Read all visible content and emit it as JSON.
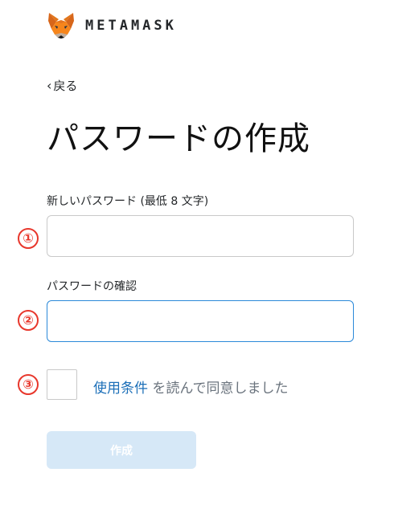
{
  "header": {
    "brand": "METAMASK",
    "logo_icon": "fox-icon"
  },
  "nav": {
    "back_label": "戻る",
    "back_icon": "chevron-left-icon"
  },
  "page": {
    "title": "パスワードの作成"
  },
  "form": {
    "new_password_label": "新しいパスワード (最低 8 文字)",
    "new_password_value": "",
    "confirm_password_label": "パスワードの確認",
    "confirm_password_value": "",
    "terms_checked": false,
    "terms_link": "使用条件",
    "terms_text": " を読んで同意しました",
    "submit_label": "作成"
  },
  "annotations": [
    "①",
    "②",
    "③"
  ],
  "colors": {
    "accent": "#1c6fb8",
    "focus_border": "#2b89d9",
    "marker": "#e8372c",
    "button_disabled_bg": "#d6e8f7"
  }
}
